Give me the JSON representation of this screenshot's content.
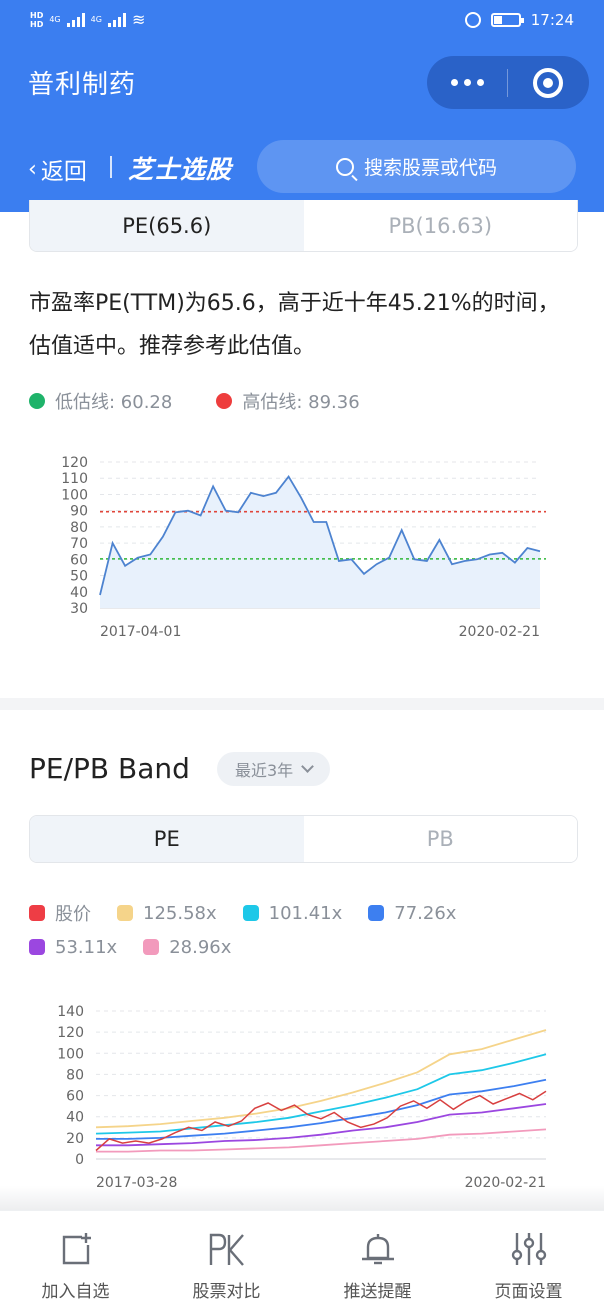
{
  "status": {
    "time": "17:24",
    "net1": "4G",
    "net2": "4G",
    "hd": "HD"
  },
  "header": {
    "title": "普利制药",
    "back_label": "返回",
    "brand": "芝士选股",
    "search_placeholder": "搜索股票或代码"
  },
  "valuation": {
    "tabs": [
      {
        "label": "PE(65.6)",
        "active": true
      },
      {
        "label": "PB(16.63)",
        "active": false
      }
    ],
    "description": "市盈率PE(TTM)为65.6，高于近十年45.21%的时间，估值适中。推荐参考此估值。",
    "legend": [
      {
        "label": "低估线: 60.28",
        "color": "#1fb36a"
      },
      {
        "label": "高估线: 89.36",
        "color": "#ee3d3d"
      }
    ]
  },
  "band": {
    "title": "PE/PB Band",
    "period": "最近3年",
    "tabs": [
      {
        "label": "PE",
        "active": true
      },
      {
        "label": "PB",
        "active": false
      }
    ],
    "legend": [
      {
        "label": "股价",
        "color": "#ee3d45"
      },
      {
        "label": "125.58x",
        "color": "#f5d48a"
      },
      {
        "label": "101.41x",
        "color": "#1ec8e8"
      },
      {
        "label": "77.26x",
        "color": "#3d7ff0"
      },
      {
        "label": "53.11x",
        "color": "#9b47e0"
      },
      {
        "label": "28.96x",
        "color": "#f29abc"
      }
    ]
  },
  "chart_data": [
    {
      "type": "area",
      "x_labels": [
        "2017-04-01",
        "2020-02-21"
      ],
      "ylim": [
        30,
        120
      ],
      "yticks": [
        30,
        40,
        50,
        60,
        70,
        80,
        90,
        100,
        110,
        120
      ],
      "grid": true,
      "reference_lines": [
        {
          "name": "低估线",
          "value": 60.28,
          "color": "#2fb838"
        },
        {
          "name": "高估线",
          "value": 89.36,
          "color": "#e0453a"
        }
      ],
      "series": [
        {
          "color": "#4d83d0",
          "values": [
            38,
            70,
            56,
            61,
            63,
            74,
            89,
            90,
            87,
            105,
            90,
            89,
            101,
            99,
            101,
            111,
            98,
            83,
            83,
            59,
            60,
            51,
            57,
            61,
            78,
            60,
            59,
            72,
            57,
            59,
            60,
            63,
            64,
            58,
            67,
            65
          ]
        }
      ]
    },
    {
      "type": "line",
      "x_labels": [
        "2017-03-28",
        "2020-02-21"
      ],
      "ylim": [
        0,
        140
      ],
      "yticks": [
        0,
        20,
        40,
        60,
        80,
        100,
        120,
        140
      ],
      "grid": true,
      "series": [
        {
          "name": "125.58x",
          "color": "#f5d48a",
          "values": [
            30,
            31,
            33,
            36,
            39,
            43,
            48,
            55,
            63,
            72,
            82,
            99,
            104,
            113,
            122
          ]
        },
        {
          "name": "101.41x",
          "color": "#1ec8e8",
          "values": [
            24,
            25,
            26,
            29,
            32,
            35,
            39,
            45,
            51,
            58,
            66,
            80,
            84,
            91,
            99
          ]
        },
        {
          "name": "77.26x",
          "color": "#3d7ff0",
          "values": [
            19,
            19,
            20,
            22,
            24,
            27,
            30,
            34,
            39,
            44,
            51,
            61,
            64,
            69,
            75
          ]
        },
        {
          "name": "53.11x",
          "color": "#9b47e0",
          "values": [
            13,
            13,
            14,
            15,
            17,
            18,
            20,
            23,
            27,
            30,
            35,
            42,
            44,
            48,
            52
          ]
        },
        {
          "name": "28.96x",
          "color": "#f29abc",
          "values": [
            7,
            7,
            8,
            8,
            9,
            10,
            11,
            13,
            15,
            17,
            19,
            23,
            24,
            26,
            28
          ]
        },
        {
          "name": "股价",
          "color": "#d84040",
          "values": [
            8,
            19,
            15,
            17,
            15,
            19,
            25,
            30,
            27,
            35,
            31,
            36,
            48,
            53,
            46,
            51,
            42,
            38,
            44,
            35,
            30,
            33,
            39,
            50,
            55,
            48,
            56,
            47,
            55,
            60,
            52,
            57,
            62,
            56,
            64
          ]
        }
      ]
    }
  ],
  "tabbar": [
    {
      "label": "加入自选",
      "icon": "add-watchlist-icon"
    },
    {
      "label": "股票对比",
      "icon": "pk-compare-icon"
    },
    {
      "label": "推送提醒",
      "icon": "bell-icon"
    },
    {
      "label": "页面设置",
      "icon": "sliders-icon"
    }
  ]
}
